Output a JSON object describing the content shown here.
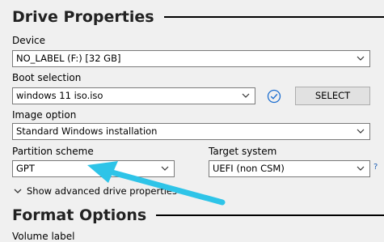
{
  "drive_properties": {
    "title": "Drive Properties",
    "device": {
      "label": "Device",
      "value": "NO_LABEL (F:) [32 GB]"
    },
    "boot_selection": {
      "label": "Boot selection",
      "value": "windows 11 iso.iso",
      "select_button": "SELECT"
    },
    "image_option": {
      "label": "Image option",
      "value": "Standard Windows installation"
    },
    "partition_scheme": {
      "label": "Partition scheme",
      "value": "GPT"
    },
    "target_system": {
      "label": "Target system",
      "value": "UEFI (non CSM)",
      "help": "?"
    },
    "advanced_toggle": "Show advanced drive properties"
  },
  "format_options": {
    "title": "Format Options",
    "volume_label": {
      "label": "Volume label"
    }
  },
  "icons": [
    "chevron-down-icon",
    "check-circle-icon",
    "help-icon",
    "annotation-arrow-icon"
  ],
  "colors": {
    "arrow": "#2ec4e8",
    "check": "#1e6fd0",
    "help": "#1e5fb4"
  }
}
